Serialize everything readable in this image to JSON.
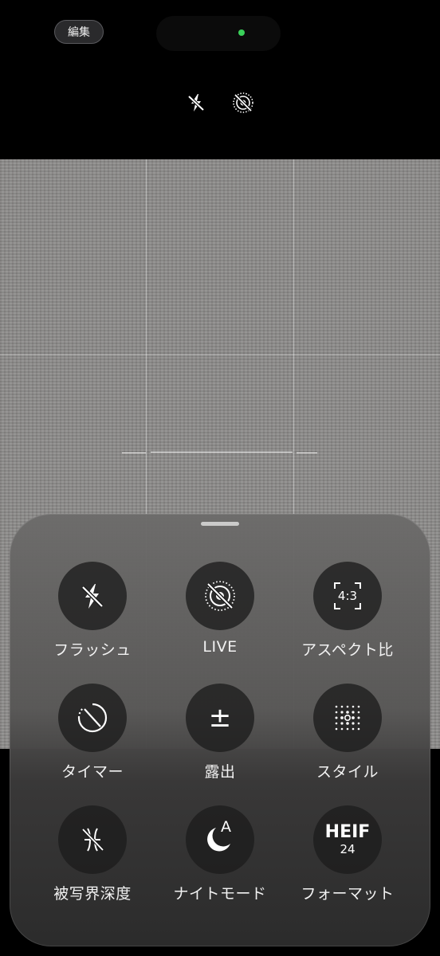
{
  "top_bar": {
    "edit_label": "編集",
    "icons": [
      "flash-off-icon",
      "live-photo-off-icon"
    ],
    "camera_in_use_indicator_color": "#3ad15a"
  },
  "controls": [
    {
      "label": "フラッシュ",
      "icon": "flash-off-icon"
    },
    {
      "label": "LIVE",
      "icon": "live-photo-off-icon"
    },
    {
      "label": "アスペクト比",
      "icon": "aspect-ratio-icon",
      "value": "4:3"
    },
    {
      "label": "タイマー",
      "icon": "timer-off-icon"
    },
    {
      "label": "露出",
      "icon": "exposure-icon",
      "value": "±"
    },
    {
      "label": "スタイル",
      "icon": "style-icon"
    },
    {
      "label": "被写界深度",
      "icon": "depth-of-field-icon"
    },
    {
      "label": "ナイトモード",
      "icon": "night-mode-auto-icon",
      "value": "A"
    },
    {
      "label": "フォーマット",
      "icon": "format-icon",
      "value": "HEIF",
      "value_sub": "24"
    }
  ]
}
